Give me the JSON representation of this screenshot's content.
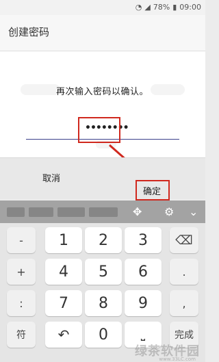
{
  "status_bar": {
    "battery": "78%",
    "time": "09:00"
  },
  "app_bar": {
    "title": "创建密码"
  },
  "main": {
    "prompt": "再次输入密码以确认。",
    "password_value": "••••••••"
  },
  "actions": {
    "cancel_label": "取消",
    "confirm_label": "确定"
  },
  "keyboard": {
    "rows": [
      [
        "-",
        "1",
        "2",
        "3",
        "backspace"
      ],
      [
        "+",
        "4",
        "5",
        "6",
        "."
      ],
      [
        ":",
        "7",
        "8",
        "9",
        ","
      ],
      [
        "符",
        "undo",
        "0",
        "space",
        "完成"
      ]
    ],
    "keys": {
      "minus": "-",
      "plus": "+",
      "colon": ":",
      "symbol": "符",
      "k1": "1",
      "k2": "2",
      "k3": "3",
      "k4": "4",
      "k5": "5",
      "k6": "6",
      "k7": "7",
      "k8": "8",
      "k9": "9",
      "k0": "0",
      "dot": ".",
      "comma": ",",
      "done": "完成"
    }
  },
  "watermark": {
    "text": "绿茶软件园",
    "sub": "www.33LC.com"
  },
  "colors": {
    "highlight": "#d0281e",
    "input_underline": "#3a3f8a",
    "keyboard_toolbar": "#a3a3a3"
  },
  "icons": [
    "cursor-move-icon",
    "gear-icon",
    "chevron-down-icon",
    "backspace-icon",
    "undo-icon",
    "space-icon",
    "wifi-icon",
    "signal-icon",
    "battery-icon"
  ]
}
